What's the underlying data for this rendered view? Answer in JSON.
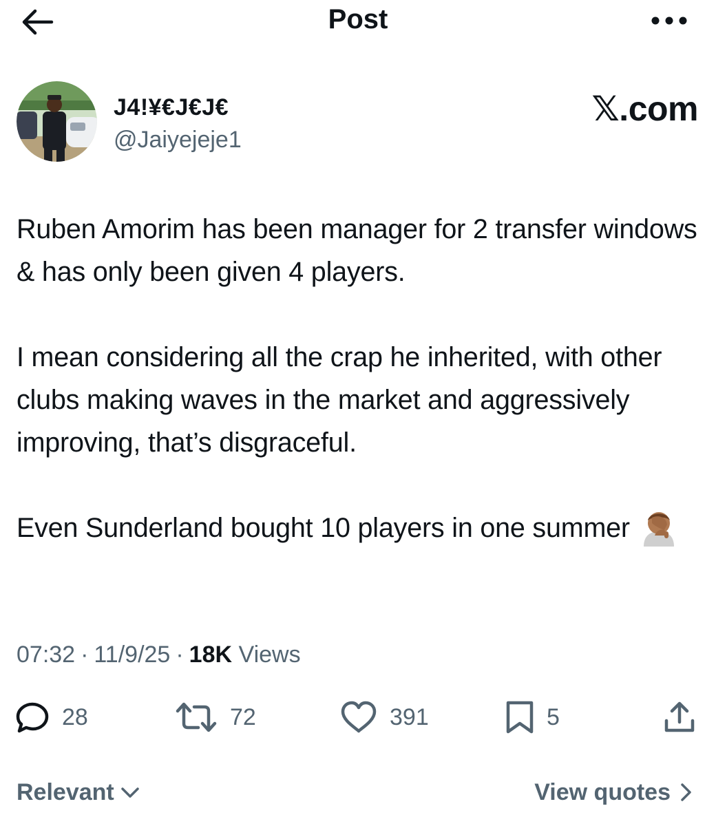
{
  "header": {
    "title": "Post",
    "back_icon": "arrow-left-icon",
    "more_icon": "more-horizontal-icon"
  },
  "author": {
    "display_name": "J4!¥€J€J€",
    "handle": "@Jaiyejeje1"
  },
  "watermark": "𝕏.com",
  "tweet": {
    "paragraphs": [
      "Ruben Amorim has been manager for 2 transfer windows & has only been given 4 players.",
      "I mean considering all the crap he inherited, with other clubs making waves in the market and aggressively improving, that’s disgraceful.",
      "Even Sunderland bought 10 players in one summer"
    ],
    "emoji": "🤦🏽‍♂️"
  },
  "meta": {
    "time": "07:32",
    "date": "11/9/25",
    "views_count": "18K",
    "views_label": "Views",
    "separator": "·"
  },
  "actions": {
    "replies": "28",
    "reposts": "72",
    "likes": "391",
    "bookmarks": "5"
  },
  "footer": {
    "sort_label": "Relevant",
    "quotes_label": "View quotes"
  },
  "colors": {
    "text_primary": "#0f1419",
    "text_secondary": "#536471"
  }
}
